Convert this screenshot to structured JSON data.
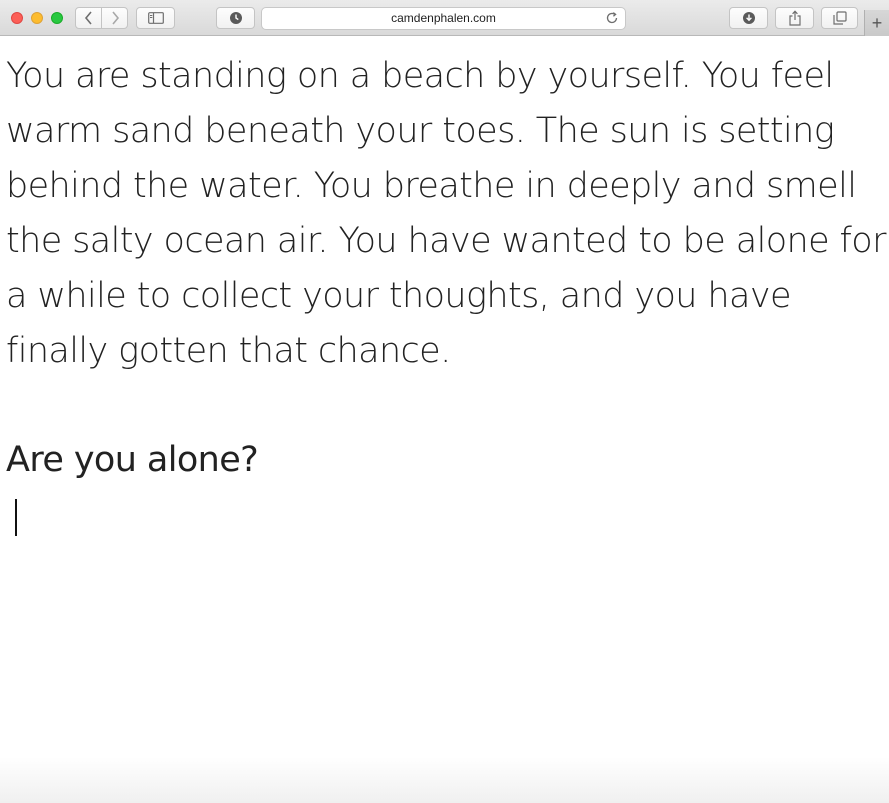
{
  "browser": {
    "url": "camdenphalen.com",
    "icons": {
      "close": "close-window-icon",
      "minimize": "minimize-window-icon",
      "maximize": "maximize-window-icon",
      "back": "chevron-left-icon",
      "forward": "chevron-right-icon",
      "sidebar": "sidebar-icon",
      "history": "clock-icon",
      "reload": "reload-icon",
      "downloads": "download-icon",
      "share": "share-icon",
      "tabs": "tabs-overview-icon",
      "new_tab": "plus-icon"
    },
    "new_tab_glyph": "+"
  },
  "page": {
    "story": "You are standing on a beach by yourself. You feel warm sand beneath your toes. The sun is setting behind the water. You breathe in deeply and smell the salty ocean air. You have wanted to be alone for a while to collect your thoughts, and you have finally gotten that chance.",
    "question": "Are you alone?",
    "answer_value": ""
  },
  "colors": {
    "text": "#222222",
    "close": "#fc5f57",
    "minimize": "#fdbc2e",
    "maximize": "#28c840"
  }
}
